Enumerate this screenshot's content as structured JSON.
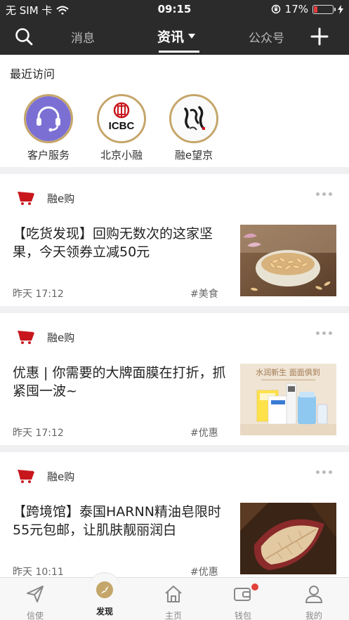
{
  "status_bar": {
    "carrier": "无 SIM 卡",
    "time": "09:15",
    "battery": "17%"
  },
  "nav": {
    "tabs": [
      "消息",
      "资讯",
      "公众号"
    ],
    "active_tab": "资讯"
  },
  "recent": {
    "title": "最近访问",
    "items": [
      {
        "label": "客户服务",
        "icon": "headset-icon"
      },
      {
        "label": "北京小融",
        "icon": "icbc-logo"
      },
      {
        "label": "融e望京",
        "icon": "calligraphy-logo"
      }
    ]
  },
  "feed": [
    {
      "source": "融e购",
      "headline": "【吃货发现】回购无数次的这家坚果，今天领券立减50元",
      "time": "昨天 17:12",
      "tag": "#美食",
      "image": "pine-nuts-bowl"
    },
    {
      "source": "融e购",
      "headline": "优惠 | 你需要的大牌面膜在打折，抓紧囤一波~",
      "time": "昨天 17:12",
      "tag": "#优惠",
      "image": "face-mask-products",
      "image_text": "水润新生 面面俱到"
    },
    {
      "source": "融e购",
      "headline": "【跨境馆】泰国HARNN精油皂限时55元包邮，让肌肤靓丽润白",
      "time": "昨天 10:11",
      "tag": "#优惠",
      "image": "leaf-soap"
    }
  ],
  "tab_bar": {
    "items": [
      "信使",
      "发现",
      "主页",
      "钱包",
      "我的"
    ],
    "active": "发现"
  },
  "colors": {
    "header_bg": "#2b2b2b",
    "accent_gold": "#c5a66a",
    "brand_red": "#c8161d"
  }
}
